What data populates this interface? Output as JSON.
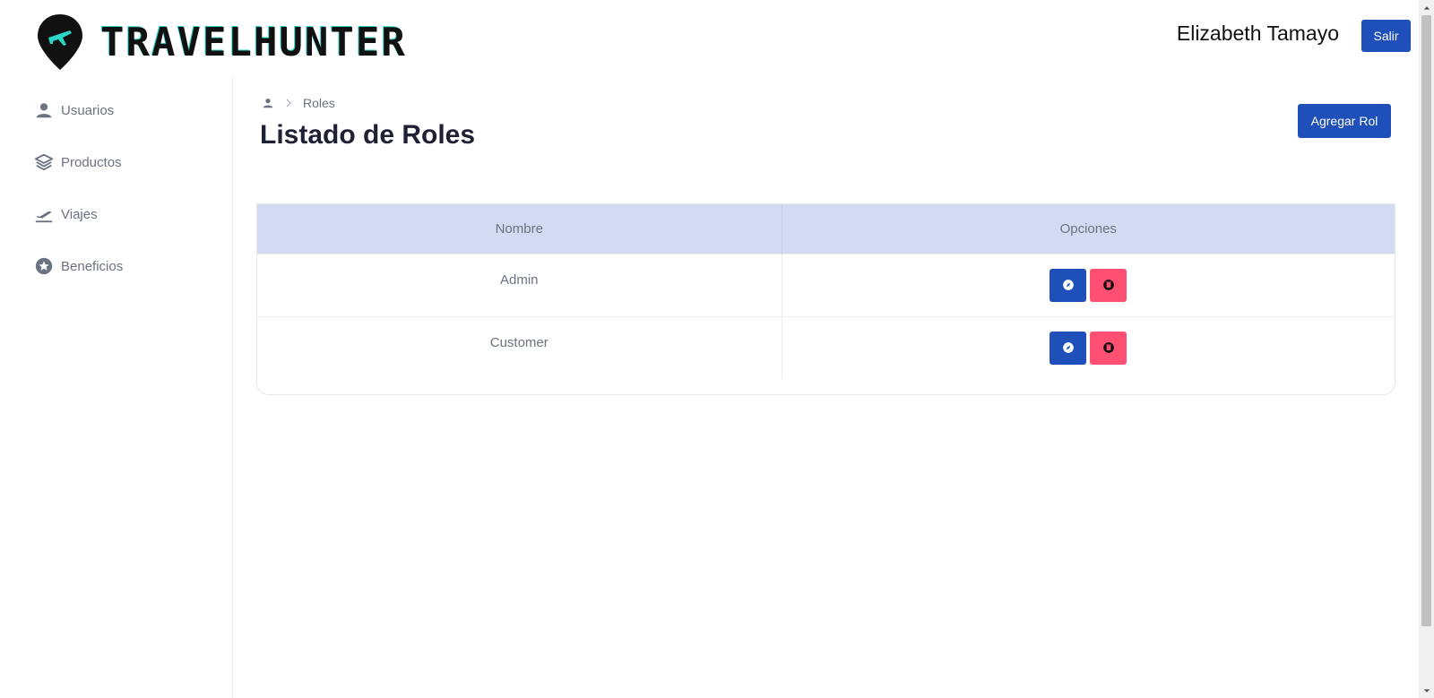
{
  "header": {
    "brand": "TRAVELHUNTER",
    "user_name": "Elizabeth Tamayo",
    "logout_label": "Salir"
  },
  "sidebar": {
    "items": [
      {
        "label": "Usuarios",
        "icon": "user-icon"
      },
      {
        "label": "Productos",
        "icon": "layers-icon"
      },
      {
        "label": "Viajes",
        "icon": "plane-departure-icon"
      },
      {
        "label": "Beneficios",
        "icon": "star-circle-icon"
      }
    ]
  },
  "breadcrumb": {
    "current": "Roles"
  },
  "main": {
    "title": "Listado de Roles",
    "add_label": "Agregar Rol"
  },
  "table": {
    "headers": [
      "Nombre",
      "Opciones"
    ],
    "rows": [
      {
        "name": "Admin"
      },
      {
        "name": "Customer"
      }
    ]
  },
  "colors": {
    "primary": "#1f4fb8",
    "danger": "#ff4f72",
    "table_header": "#d3dbf2",
    "brand_accent": "#2ad6c6"
  }
}
